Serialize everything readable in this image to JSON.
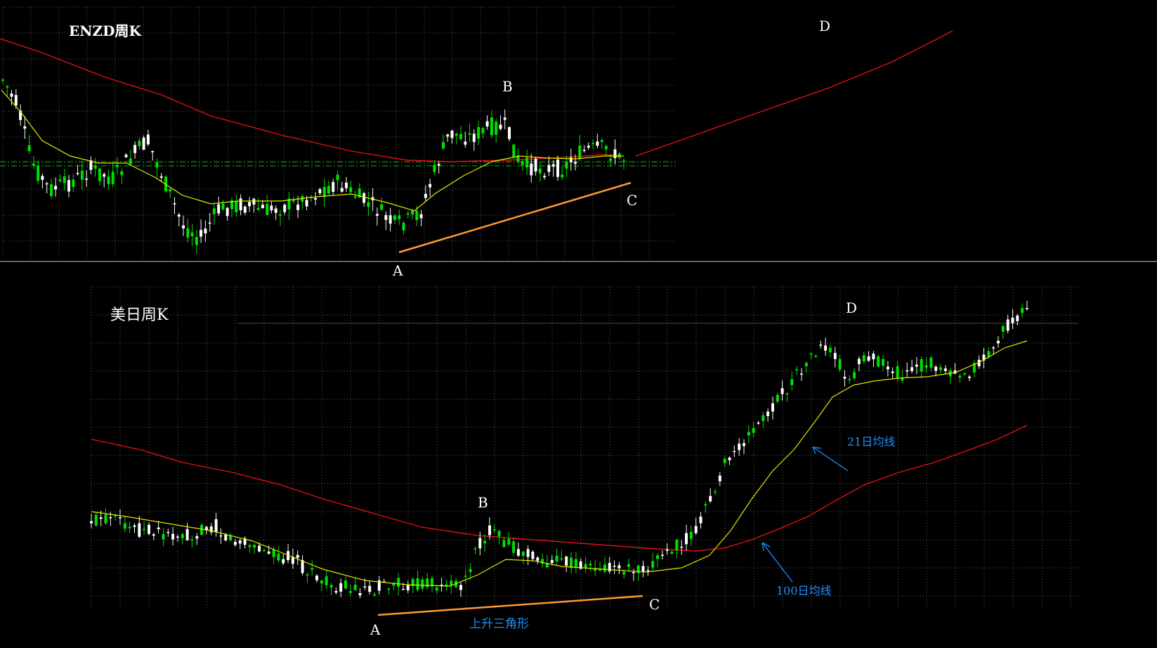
{
  "colors": {
    "background": "#000000",
    "candle_up": "#ffffff",
    "candle_down": "#00e000",
    "ma21": "#e6e600",
    "ma100": "#e01010",
    "trendline": "#ff9933",
    "level_line": "#00c000",
    "grid": "#5a5a5a",
    "label": "#ffffff",
    "annotation": "#1e90ff",
    "arrow": "#1e90ff",
    "separator": "#c8c8c8"
  },
  "chart_data": [
    {
      "type": "candlestick",
      "title": "ENZD周K",
      "candle_count": 142,
      "indicators": [
        "ma21",
        "ma100"
      ],
      "points": {
        "A": "A",
        "B": "B",
        "C": "C",
        "D": "D"
      },
      "ma100_projection": "rising toward D",
      "horizontal_levels": 2,
      "trendline": "A-C ascending support",
      "grid": true
    },
    {
      "type": "candlestick",
      "title": "美日周K",
      "candle_count": 196,
      "indicators": [
        "ma21",
        "ma100"
      ],
      "points": {
        "A": "A",
        "B": "B",
        "C": "C",
        "D": "D"
      },
      "annotations": {
        "pattern": "上升三角形",
        "ma21": "21日均线",
        "ma100": "100日均线"
      },
      "trendline": "A-C ascending support",
      "grid": true
    }
  ]
}
